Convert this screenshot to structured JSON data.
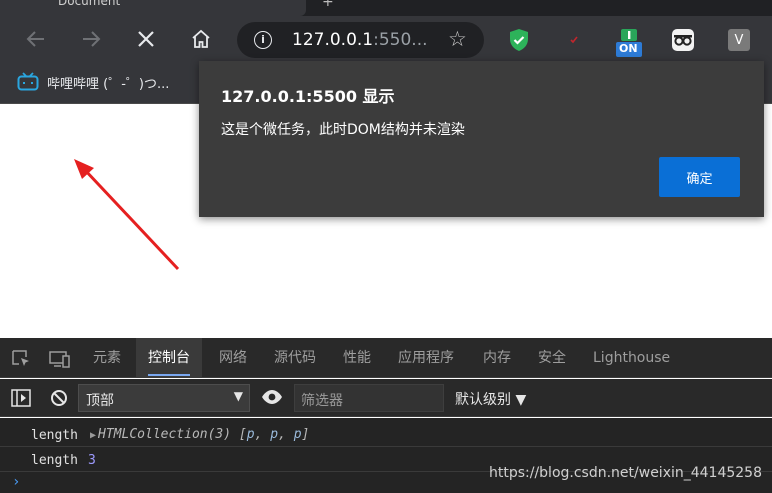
{
  "browser": {
    "tab_title": "Document",
    "new_tab": "+",
    "url_host": "127.0.0.1",
    "url_rest": ":550...",
    "bookmark_label": "哔哩哔哩 (゜-゜)つ..."
  },
  "extensions": {
    "on_badge": "ON",
    "v_label": "V"
  },
  "dialog": {
    "title": "127.0.0.1:5500 显示",
    "message": "这是个微任务，此时DOM结构并未渲染",
    "ok_label": "确定"
  },
  "devtools": {
    "tabs": [
      "元素",
      "控制台",
      "网络",
      "源代码",
      "性能",
      "应用程序",
      "内存",
      "安全",
      "Lighthouse"
    ],
    "active_tab": "控制台",
    "context": "顶部",
    "filter_placeholder": "筛选器",
    "level": "默认级别 ▼"
  },
  "console": {
    "row1_key": "length",
    "row1_value_type": "HTMLCollection(3)",
    "row1_items": [
      "p",
      "p",
      "p"
    ],
    "row2_key": "length",
    "row2_value": "3",
    "prompt": "›"
  },
  "watermark": "https://blog.csdn.net/weixin_44145258",
  "colors": {
    "accent_blue": "#0a6fd6",
    "annotation_red": "#e52020"
  }
}
